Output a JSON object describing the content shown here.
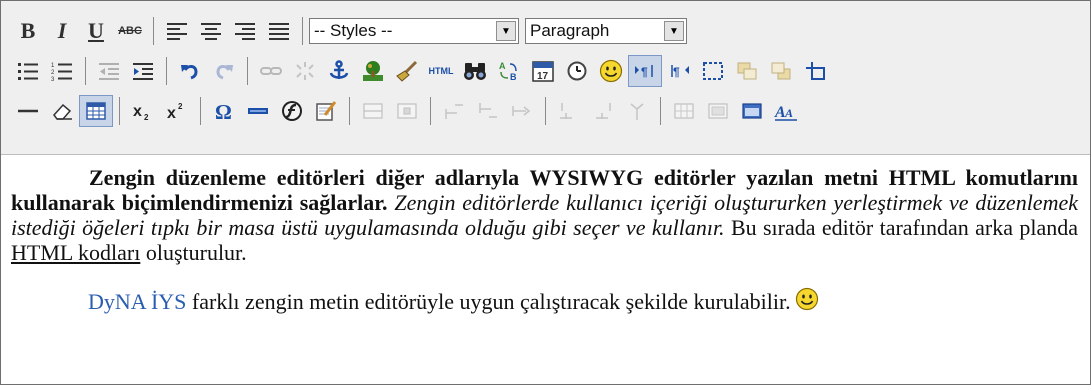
{
  "toolbar": {
    "styles_select": "-- Styles --",
    "format_select": "Paragraph",
    "html_label": "HTML",
    "abc_label": "ABC",
    "accent": "#2a5db0"
  },
  "content": {
    "para1_bold": "Zengin düzenleme editörleri diğer adlarıyla WYSIWYG editörler yazılan metni HTML komutlarını kullanarak biçimlendirmenizi sağlarlar.",
    "para1_italic": "Zengin editörlerde kullanıcı içeriği oluştururken yerleştirmek ve düzenlemek istediği öğeleri tıpkı bir masa üstü uygulamasında olduğu gibi seçer ve kullanır.",
    "para1_plain_a": "Bu sırada editör tarafından arka planda",
    "para1_underlined": "HTML kodları",
    "para1_plain_b": "oluşturulur.",
    "para2_link": "DyNA İYS",
    "para2_text": "farklı zengin metin editörüyle uygun çalıştıracak şekilde kurulabilir."
  }
}
